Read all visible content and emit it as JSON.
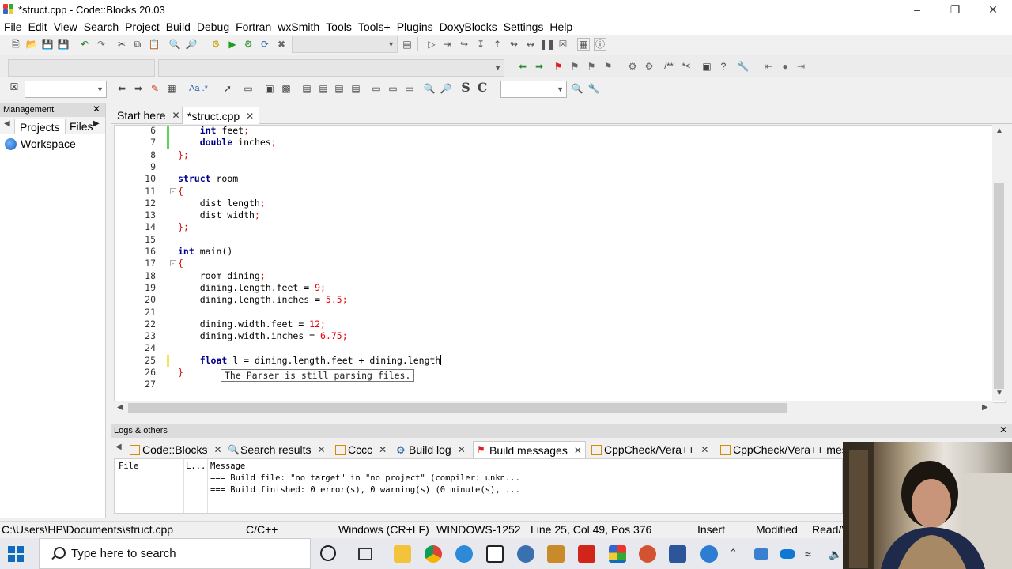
{
  "window": {
    "title": "*struct.cpp - Code::Blocks 20.03",
    "controls": [
      "minimize",
      "maximize",
      "close"
    ]
  },
  "menu": [
    "File",
    "Edit",
    "View",
    "Search",
    "Project",
    "Build",
    "Debug",
    "Fortran",
    "wxSmith",
    "Tools",
    "Tools+",
    "Plugins",
    "DoxyBlocks",
    "Settings",
    "Help"
  ],
  "toolbar": {
    "regex_label": "Aa .*",
    "bold_s": "S",
    "bold_c": "C"
  },
  "management": {
    "title": "Management",
    "tabs": [
      "Projects",
      "Files"
    ],
    "workspace": "Workspace"
  },
  "editor": {
    "tabs": [
      {
        "label": "Start here",
        "active": false
      },
      {
        "label": "*struct.cpp",
        "active": true
      }
    ],
    "lines": [
      {
        "n": "6",
        "text": "    int feet;"
      },
      {
        "n": "7",
        "text": "    double inches;"
      },
      {
        "n": "8",
        "text": "};"
      },
      {
        "n": "9",
        "text": ""
      },
      {
        "n": "10",
        "text": "struct room"
      },
      {
        "n": "11",
        "text": "{"
      },
      {
        "n": "12",
        "text": "    dist length;"
      },
      {
        "n": "13",
        "text": "    dist width;"
      },
      {
        "n": "14",
        "text": "};"
      },
      {
        "n": "15",
        "text": ""
      },
      {
        "n": "16",
        "text": "int main()"
      },
      {
        "n": "17",
        "text": "{"
      },
      {
        "n": "18",
        "text": "    room dining;"
      },
      {
        "n": "19",
        "text": "    dining.length.feet = 9;"
      },
      {
        "n": "20",
        "text": "    dining.length.inches = 5.5;"
      },
      {
        "n": "21",
        "text": ""
      },
      {
        "n": "22",
        "text": "    dining.width.feet = 12;"
      },
      {
        "n": "23",
        "text": "    dining.width.inches = 6.75;"
      },
      {
        "n": "24",
        "text": ""
      },
      {
        "n": "25",
        "text": "    float l = dining.length.feet + dining.length"
      },
      {
        "n": "26",
        "text": "}"
      },
      {
        "n": "27",
        "text": ""
      }
    ],
    "tooltip": "The Parser is still parsing files."
  },
  "logs": {
    "title": "Logs & others",
    "tabs": [
      {
        "label": "Code::Blocks",
        "icon": "document-icon"
      },
      {
        "label": "Search results",
        "icon": "search-icon"
      },
      {
        "label": "Cccc",
        "icon": "document-icon"
      },
      {
        "label": "Build log",
        "icon": "gear-icon"
      },
      {
        "label": "Build messages",
        "icon": "pin-icon",
        "active": true
      },
      {
        "label": "CppCheck/Vera++",
        "icon": "document-icon"
      },
      {
        "label": "CppCheck/Vera++ mes",
        "icon": "document-icon"
      }
    ],
    "columns": [
      "File",
      "L...",
      "Message"
    ],
    "rows": [
      {
        "file": "",
        "line": "",
        "message": "=== Build file: \"no target\" in \"no project\" (compiler: unkn..."
      },
      {
        "file": "",
        "line": "",
        "message": "=== Build finished: 0 error(s), 0 warning(s) (0 minute(s), ..."
      }
    ]
  },
  "status": {
    "path": "C:\\Users\\HP\\Documents\\struct.cpp",
    "language": "C/C++",
    "eol": "Windows (CR+LF)",
    "encoding": "WINDOWS-1252",
    "position": "Line 25, Col 49, Pos 376",
    "mode": "Insert",
    "modified": "Modified",
    "access": "Read/V"
  },
  "taskbar": {
    "search_placeholder": "Type here to search"
  },
  "colors": {
    "keyword": "#00008b",
    "number": "#e8000b",
    "brace": "#cc1111",
    "changed_marker": "#f2e35c",
    "saved_marker": "#5ad45a"
  }
}
